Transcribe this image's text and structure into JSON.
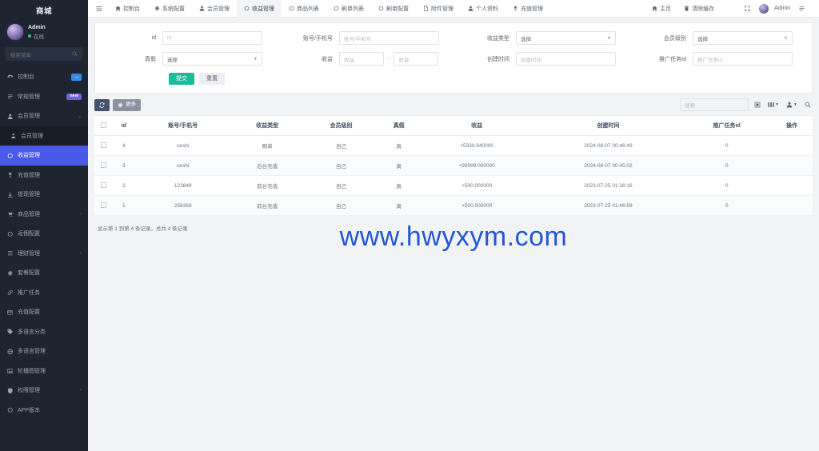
{
  "sidebar": {
    "brand": "商城",
    "user": {
      "name": "Admin",
      "status": "在线"
    },
    "search_placeholder": "搜索菜单",
    "items": [
      {
        "label": "控制台",
        "icon": "dashboard-icon",
        "badge": "...",
        "badge_color": "#2f8fe8",
        "state": "normal"
      },
      {
        "label": "常规管理",
        "icon": "settings-icon",
        "badge": "new",
        "badge_color": "#6f63d6",
        "state": "normal"
      },
      {
        "label": "会员管理",
        "icon": "user-icon",
        "caret": "⌄",
        "state": "expanded"
      },
      {
        "label": "会员管理",
        "icon": "user-small-icon",
        "state": "child"
      },
      {
        "label": "收益管理",
        "icon": "circle-icon",
        "state": "active"
      },
      {
        "label": "充值管理",
        "icon": "money-icon",
        "state": "normal"
      },
      {
        "label": "提现管理",
        "icon": "withdraw-icon",
        "state": "normal"
      },
      {
        "label": "商品管理",
        "icon": "cart-icon",
        "caret": "‹",
        "state": "normal"
      },
      {
        "label": "返佣配置",
        "icon": "circle-icon",
        "state": "normal"
      },
      {
        "label": "理财管理",
        "icon": "list-icon",
        "caret": "‹",
        "state": "normal"
      },
      {
        "label": "套餐配置",
        "icon": "gear-icon",
        "state": "normal"
      },
      {
        "label": "推广任务",
        "icon": "link-icon",
        "state": "normal"
      },
      {
        "label": "充值配置",
        "icon": "card-icon",
        "state": "normal"
      },
      {
        "label": "多语言分类",
        "icon": "tag-icon",
        "state": "normal"
      },
      {
        "label": "多语言管理",
        "icon": "globe-icon",
        "state": "normal"
      },
      {
        "label": "轮播图管理",
        "icon": "image-icon",
        "state": "normal"
      },
      {
        "label": "权限管理",
        "icon": "shield-icon",
        "caret": "‹",
        "state": "normal"
      },
      {
        "label": "APP版本",
        "icon": "circle-icon",
        "state": "normal"
      }
    ]
  },
  "topbar": {
    "tabs": [
      {
        "label": "控制台",
        "icon": "home-icon",
        "active": false
      },
      {
        "label": "系统配置",
        "icon": "gear-icon",
        "active": false
      },
      {
        "label": "会员管理",
        "icon": "user-icon",
        "active": false
      },
      {
        "label": "收益管理",
        "icon": "circle-icon",
        "active": true
      },
      {
        "label": "商品列表",
        "icon": "circle-icon",
        "active": false
      },
      {
        "label": "刷单列表",
        "icon": "circle-icon",
        "active": false
      },
      {
        "label": "刷单配置",
        "icon": "circle-icon",
        "active": false
      },
      {
        "label": "附件管理",
        "icon": "file-icon",
        "active": false
      },
      {
        "label": "个人资料",
        "icon": "user-icon",
        "active": false
      },
      {
        "label": "充值管理",
        "icon": "money-icon",
        "active": false
      }
    ],
    "right": [
      {
        "label": "主页",
        "icon": "home-icon"
      },
      {
        "label": "清除缓存",
        "icon": "trash-icon"
      }
    ],
    "user_label": "Admin"
  },
  "filter": {
    "id_label": "id",
    "id_placeholder": "id",
    "account_label": "账号/手机号",
    "account_placeholder": "账号/手机号",
    "income_type_label": "收益类型",
    "income_type_value": "选择",
    "member_level_label": "会员级别",
    "member_level_value": "选择",
    "truefalse_label": "真假",
    "truefalse_value": "选择",
    "income_label": "收益",
    "income_min_placeholder": "收益",
    "income_max_placeholder": "收益",
    "range_sep": "-",
    "create_time_label": "创建时间",
    "create_time_placeholder": "创建时间",
    "task_id_label": "推广任务Id",
    "task_id_placeholder": "推广任务id",
    "submit_label": "提交",
    "reset_label": "重置"
  },
  "toolbar": {
    "refresh_icon": "refresh-icon",
    "more_label": "更多",
    "search_placeholder": "搜索"
  },
  "table": {
    "columns": [
      "",
      "id",
      "账号/手机号",
      "收益类型",
      "会员级别",
      "真假",
      "收益",
      "创建时间",
      "推广任务id",
      "操作"
    ],
    "rows": [
      {
        "id": "4",
        "account": "ceshi",
        "type": "刷单",
        "level": "自己",
        "truefalse": "真",
        "income": "+5339.940000",
        "created": "2024-08-07 00:46:49",
        "task_id": "0",
        "action": ""
      },
      {
        "id": "3",
        "account": "ceshi",
        "type": "后台充值",
        "level": "自己",
        "truefalse": "真",
        "income": "+99999.000000",
        "created": "2024-08-07 00:45:02",
        "task_id": "0",
        "action": ""
      },
      {
        "id": "2",
        "account": "123849",
        "type": "前台充值",
        "level": "自己",
        "truefalse": "真",
        "income": "+500.000000",
        "created": "2023-07-25 01:26:16",
        "task_id": "0",
        "action": ""
      },
      {
        "id": "1",
        "account": "258369",
        "type": "前台充值",
        "level": "自己",
        "truefalse": "真",
        "income": "+500.000000",
        "created": "2023-07-25 01:46:59",
        "task_id": "0",
        "action": ""
      }
    ],
    "footer": "显示第 1 到第 4 条记录，总共 4 条记录"
  },
  "watermark": "www.hwyxym.com",
  "colors": {
    "accent": "#4a5ae8",
    "submit": "#1abc9c",
    "sidebar_bg": "#1e2430",
    "watermark": "#2257d6"
  }
}
